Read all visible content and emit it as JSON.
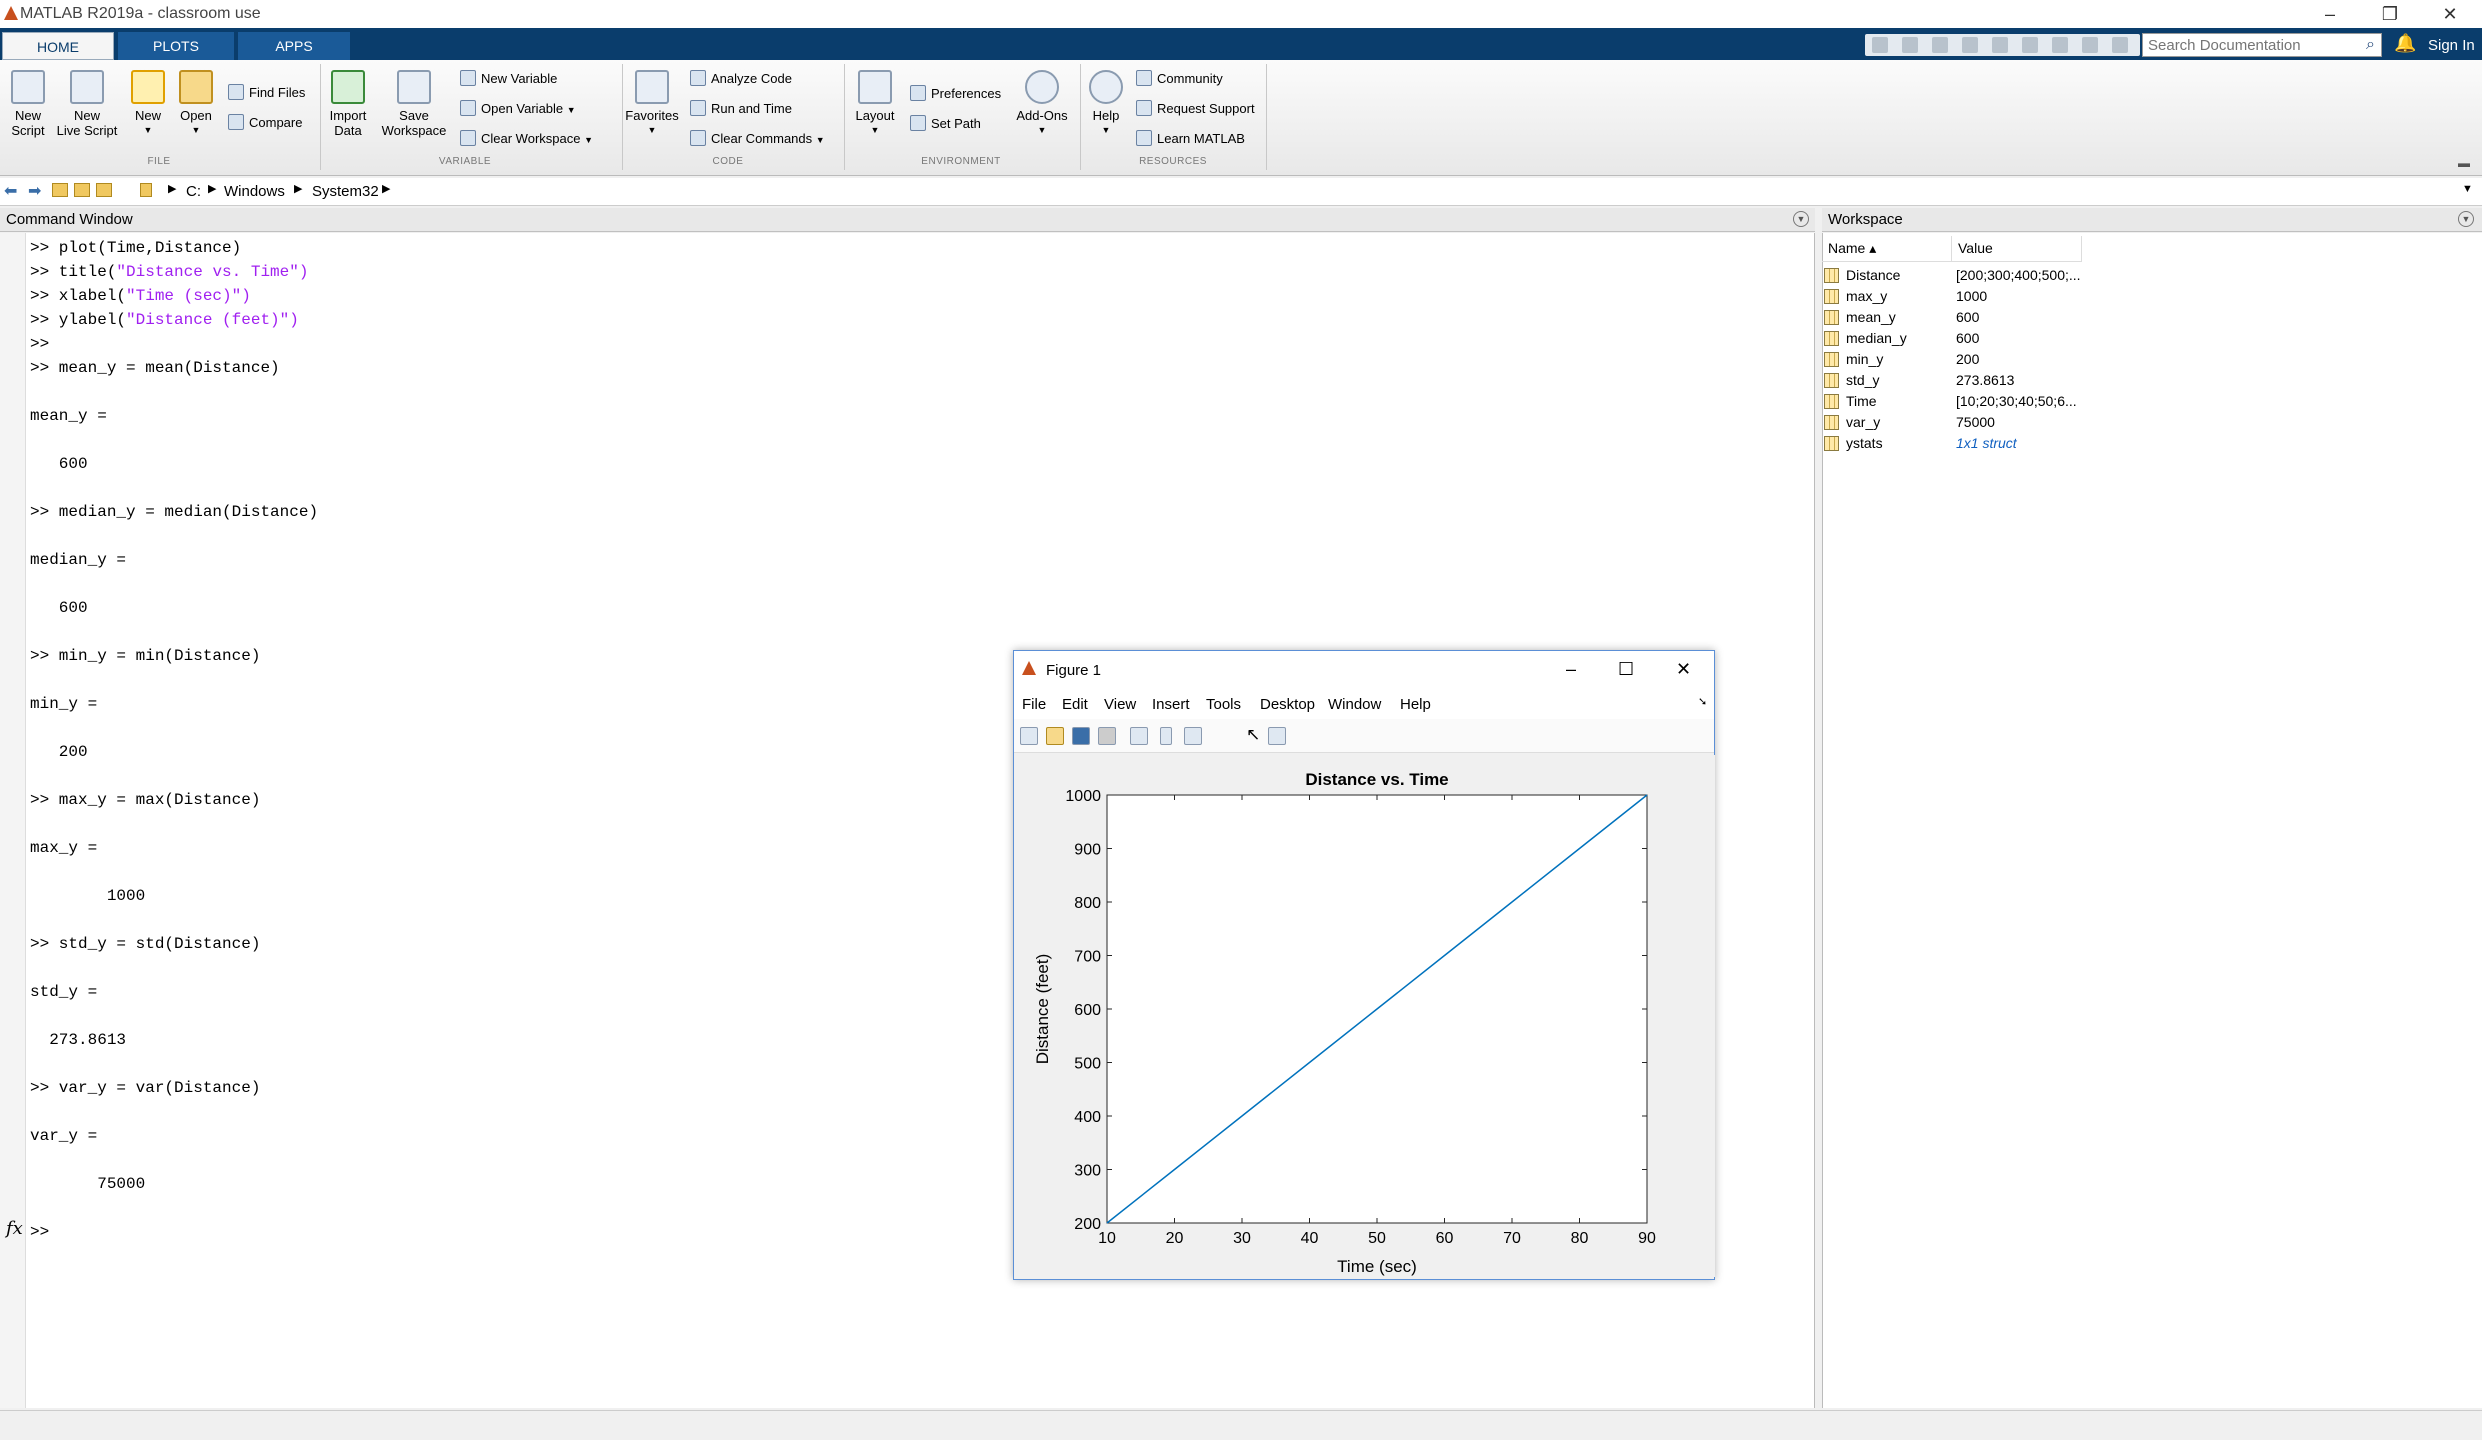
{
  "window": {
    "title": "MATLAB R2019a - classroom use"
  },
  "tabs": [
    "HOME",
    "PLOTS",
    "APPS"
  ],
  "search": {
    "placeholder": "Search Documentation"
  },
  "signin": "Sign In",
  "ribbon": {
    "file": {
      "new_script": "New\nScript",
      "new_live_script": "New\nLive Script",
      "new": "New",
      "open": "Open",
      "find_files": "Find Files",
      "compare": "Compare",
      "group": "FILE"
    },
    "variable": {
      "import_data": "Import\nData",
      "save_workspace": "Save\nWorkspace",
      "new_variable": "New Variable",
      "open_variable": "Open Variable",
      "clear_workspace": "Clear Workspace",
      "group": "VARIABLE"
    },
    "code": {
      "favorites": "Favorites",
      "analyze_code": "Analyze Code",
      "run_and_time": "Run and Time",
      "clear_commands": "Clear Commands",
      "group": "CODE"
    },
    "environment": {
      "layout": "Layout",
      "preferences": "Preferences",
      "set_path": "Set Path",
      "addons": "Add-Ons",
      "group": "ENVIRONMENT"
    },
    "resources": {
      "help": "Help",
      "community": "Community",
      "request_support": "Request Support",
      "learn_matlab": "Learn MATLAB",
      "group": "RESOURCES"
    }
  },
  "path": {
    "drive": "C:",
    "dir1": "Windows",
    "dir2": "System32"
  },
  "command_window": {
    "title": "Command Window",
    "lines": [
      ">> plot(Time,Distance)",
      ">> title(",
      ">> xlabel(",
      ">> ylabel(",
      ">>",
      ">> mean_y = mean(Distance)",
      "mean_y =",
      "   600",
      ">> median_y = median(Distance)",
      "median_y =",
      "   600",
      ">> min_y = min(Distance)",
      "min_y =",
      "   200",
      ">> max_y = max(Distance)",
      "max_y =",
      "        1000",
      ">> std_y = std(Distance)",
      "std_y =",
      "  273.8613",
      ">> var_y = var(Distance)",
      "var_y =",
      "       75000",
      ">>"
    ],
    "strings": [
      "\"Distance vs. Time\")",
      "\"Time (sec)\")",
      "\"Distance (feet)\")"
    ],
    "fx": "fx"
  },
  "workspace": {
    "title": "Workspace",
    "col_name": "Name ▴",
    "col_value": "Value",
    "rows": [
      {
        "name": "Distance",
        "value": "[200;300;400;500;..."
      },
      {
        "name": "max_y",
        "value": "1000"
      },
      {
        "name": "mean_y",
        "value": "600"
      },
      {
        "name": "median_y",
        "value": "600"
      },
      {
        "name": "min_y",
        "value": "200"
      },
      {
        "name": "std_y",
        "value": "273.8613"
      },
      {
        "name": "Time",
        "value": "[10;20;30;40;50;6..."
      },
      {
        "name": "var_y",
        "value": "75000"
      },
      {
        "name": "ystats",
        "value": "1x1 struct"
      }
    ]
  },
  "figure": {
    "title": "Figure 1",
    "menu": [
      "File",
      "Edit",
      "View",
      "Insert",
      "Tools",
      "Desktop",
      "Window",
      "Help"
    ]
  },
  "chart_data": {
    "type": "line",
    "title": "Distance vs. Time",
    "xlabel": "Time (sec)",
    "ylabel": "Distance (feet)",
    "x": [
      10,
      20,
      30,
      40,
      50,
      60,
      70,
      80,
      90
    ],
    "series": [
      {
        "values": [
          200,
          300,
          400,
          500,
          600,
          700,
          800,
          900,
          1000
        ]
      }
    ],
    "xlim": [
      10,
      90
    ],
    "ylim": [
      200,
      1000
    ],
    "xticks": [
      10,
      20,
      30,
      40,
      50,
      60,
      70,
      80,
      90
    ],
    "yticks": [
      200,
      300,
      400,
      500,
      600,
      700,
      800,
      900,
      1000
    ],
    "grid": false,
    "line_color": "#0072bd"
  }
}
